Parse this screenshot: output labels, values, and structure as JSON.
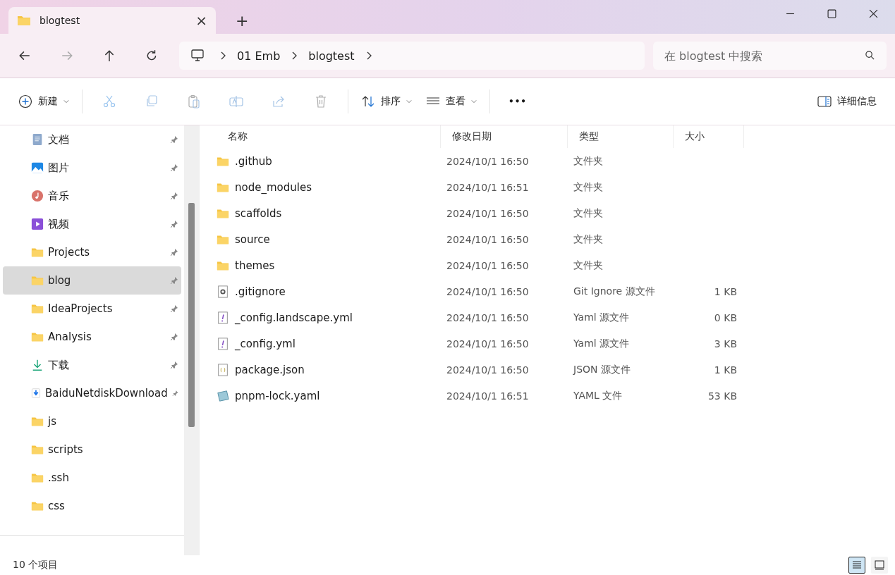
{
  "tab": {
    "title": "blogtest",
    "close": "×",
    "new": "+"
  },
  "address": {
    "crumbs": [
      "01 Emb",
      "blogtest"
    ]
  },
  "search": {
    "placeholder": "在 blogtest 中搜索"
  },
  "toolbar": {
    "new": "新建",
    "actions": [
      {
        "kind": "cut",
        "disabled": true
      },
      {
        "kind": "copy",
        "disabled": true
      },
      {
        "kind": "paste",
        "disabled": true
      },
      {
        "kind": "rename",
        "disabled": true
      },
      {
        "kind": "share",
        "disabled": true
      },
      {
        "kind": "delete",
        "disabled": true
      }
    ],
    "sort": "排序",
    "view": "查看",
    "more": "•••",
    "details": "详细信息"
  },
  "sidebar": {
    "items": [
      {
        "label": "文档",
        "kind": "docs",
        "pinned": true,
        "selected": false
      },
      {
        "label": "图片",
        "kind": "pictures",
        "pinned": true,
        "selected": false
      },
      {
        "label": "音乐",
        "kind": "music",
        "pinned": true,
        "selected": false
      },
      {
        "label": "视频",
        "kind": "videos",
        "pinned": true,
        "selected": false
      },
      {
        "label": "Projects",
        "kind": "folder",
        "pinned": true,
        "selected": false
      },
      {
        "label": "blog",
        "kind": "folder",
        "pinned": true,
        "selected": true
      },
      {
        "label": "IdeaProjects",
        "kind": "folder",
        "pinned": true,
        "selected": false
      },
      {
        "label": "Analysis",
        "kind": "folder",
        "pinned": true,
        "selected": false
      },
      {
        "label": "下载",
        "kind": "downloads",
        "pinned": true,
        "selected": false
      },
      {
        "label": "BaiduNetdiskDownload",
        "kind": "download-file",
        "pinned": true,
        "selected": false
      },
      {
        "label": "js",
        "kind": "folder",
        "pinned": false,
        "selected": false
      },
      {
        "label": "scripts",
        "kind": "folder",
        "pinned": false,
        "selected": false
      },
      {
        "label": ".ssh",
        "kind": "folder",
        "pinned": false,
        "selected": false
      },
      {
        "label": "css",
        "kind": "folder",
        "pinned": false,
        "selected": false
      }
    ]
  },
  "table": {
    "columns": [
      "名称",
      "修改日期",
      "类型",
      "大小"
    ],
    "rows": [
      {
        "name": ".github",
        "kind": "folder",
        "date": "2024/10/1 16:50",
        "type": "文件夹"
      },
      {
        "name": "node_modules",
        "kind": "folder",
        "date": "2024/10/1 16:51",
        "type": "文件夹"
      },
      {
        "name": "scaffolds",
        "kind": "folder",
        "date": "2024/10/1 16:50",
        "type": "文件夹"
      },
      {
        "name": "source",
        "kind": "folder",
        "date": "2024/10/1 16:50",
        "type": "文件夹"
      },
      {
        "name": "themes",
        "kind": "folder",
        "date": "2024/10/1 16:50",
        "type": "文件夹"
      },
      {
        "name": ".gitignore",
        "kind": "settings",
        "date": "2024/10/1 16:50",
        "type": "Git Ignore 源文件",
        "size": "1 KB"
      },
      {
        "name": "_config.landscape.yml",
        "kind": "yml",
        "date": "2024/10/1 16:50",
        "type": "Yaml 源文件",
        "size": "0 KB"
      },
      {
        "name": "_config.yml",
        "kind": "yml",
        "date": "2024/10/1 16:50",
        "type": "Yaml 源文件",
        "size": "3 KB"
      },
      {
        "name": "package.json",
        "kind": "json",
        "date": "2024/10/1 16:50",
        "type": "JSON 源文件",
        "size": "1 KB"
      },
      {
        "name": "pnpm-lock.yaml",
        "kind": "yaml",
        "date": "2024/10/1 16:51",
        "type": "YAML 文件",
        "size": "53 KB"
      }
    ]
  },
  "status_bar": {
    "count": "10 个项目",
    "views": [
      {
        "kind": "details",
        "selected": true
      },
      {
        "kind": "tiles",
        "selected": false
      }
    ]
  }
}
